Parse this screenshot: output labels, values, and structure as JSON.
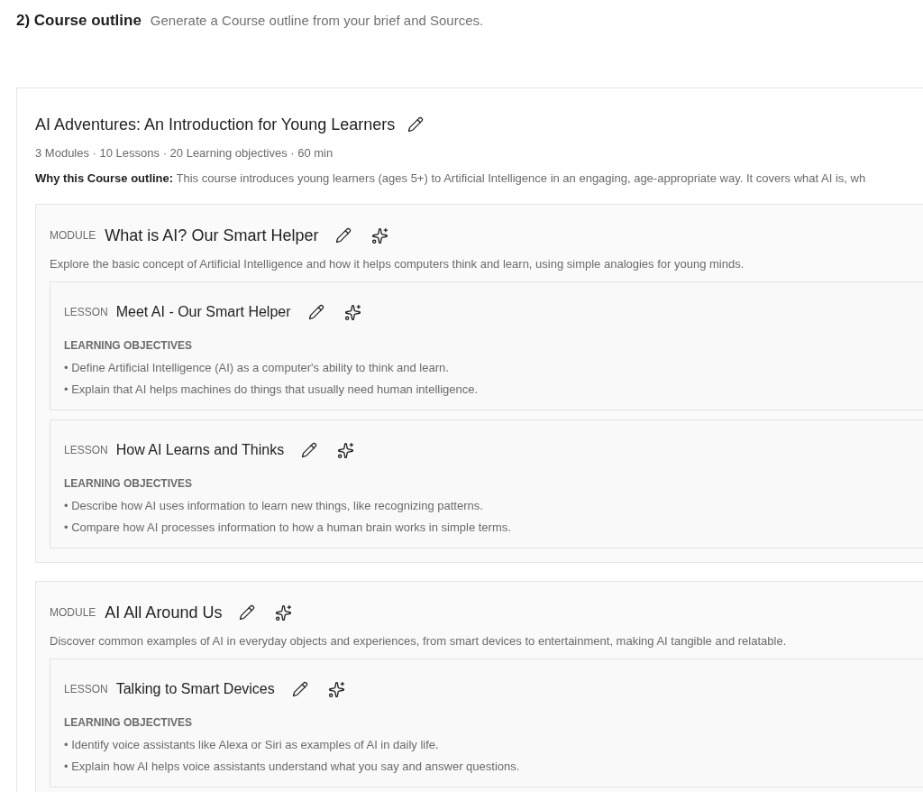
{
  "header": {
    "title": "2) Course outline",
    "description": "Generate a Course outline from your brief and Sources."
  },
  "course": {
    "title": "AI Adventures: An Introduction for Young Learners",
    "meta": "3 Modules · 10 Lessons · 20 Learning objectives · 60 min",
    "rationale": "**Why this Course outline:** This course introduces young learners (ages 5+) to Artificial Intelligence in an engaging, age-appropriate way. It covers what AI is, wh"
  },
  "modules": [
    {
      "label": "MODULE",
      "title": "What is AI? Our Smart Helper",
      "description": "Explore the basic concept of Artificial Intelligence and how it helps computers think and learn, using simple analogies for young minds.",
      "lessons": [
        {
          "label": "LESSON",
          "title": "Meet AI - Our Smart Helper",
          "objectives_heading": "LEARNING OBJECTIVES",
          "objectives": [
            "• Define Artificial Intelligence (AI) as a computer's ability to think and learn.",
            "• Explain that AI helps machines do things that usually need human intelligence."
          ]
        },
        {
          "label": "LESSON",
          "title": "How AI Learns and Thinks",
          "objectives_heading": "LEARNING OBJECTIVES",
          "objectives": [
            "• Describe how AI uses information to learn new things, like recognizing patterns.",
            "• Compare how AI processes information to how a human brain works in simple terms."
          ]
        }
      ]
    },
    {
      "label": "MODULE",
      "title": "AI All Around Us",
      "description": "Discover common examples of AI in everyday objects and experiences, from smart devices to entertainment, making AI tangible and relatable.",
      "lessons": [
        {
          "label": "LESSON",
          "title": "Talking to Smart Devices",
          "objectives_heading": "LEARNING OBJECTIVES",
          "objectives": [
            "• Identify voice assistants like Alexa or Siri as examples of AI in daily life.",
            "• Explain how AI helps voice assistants understand what you say and answer questions."
          ]
        }
      ]
    }
  ]
}
